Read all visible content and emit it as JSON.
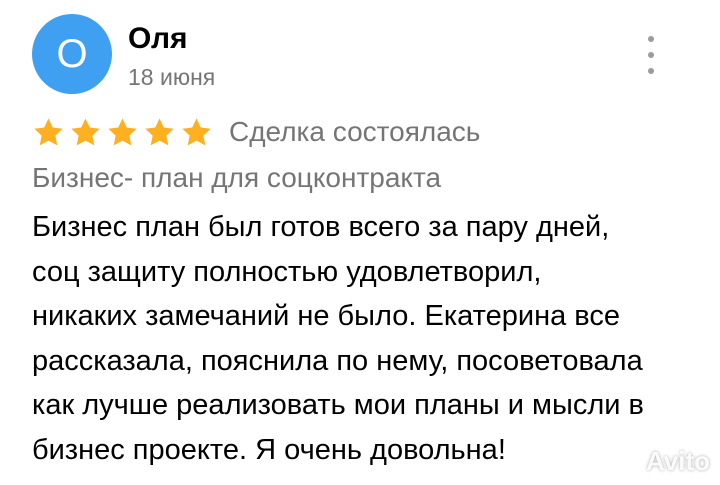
{
  "review": {
    "avatar_letter": "О",
    "avatar_color": "#3fa0f2",
    "author_name": "Оля",
    "date": "18 июня",
    "more_icon": "vertical-ellipsis-icon",
    "rating": 5,
    "rating_max": 5,
    "star_color": "#ffb021",
    "deal_status": "Сделка состоялась",
    "service": "Бизнес- план для соцконтракта",
    "text_lines": [
      "Бизнес план был готов всего за пару дней,",
      "соц защиту полностью удовлетворил,",
      "никаких замечаний не было. Екатерина все",
      "рассказала, пояснила по нему, посоветовала",
      "как лучше реализовать мои планы и мысли в",
      "бизнес проекте. Я очень довольна!"
    ]
  },
  "watermark": {
    "text": "Avito"
  }
}
